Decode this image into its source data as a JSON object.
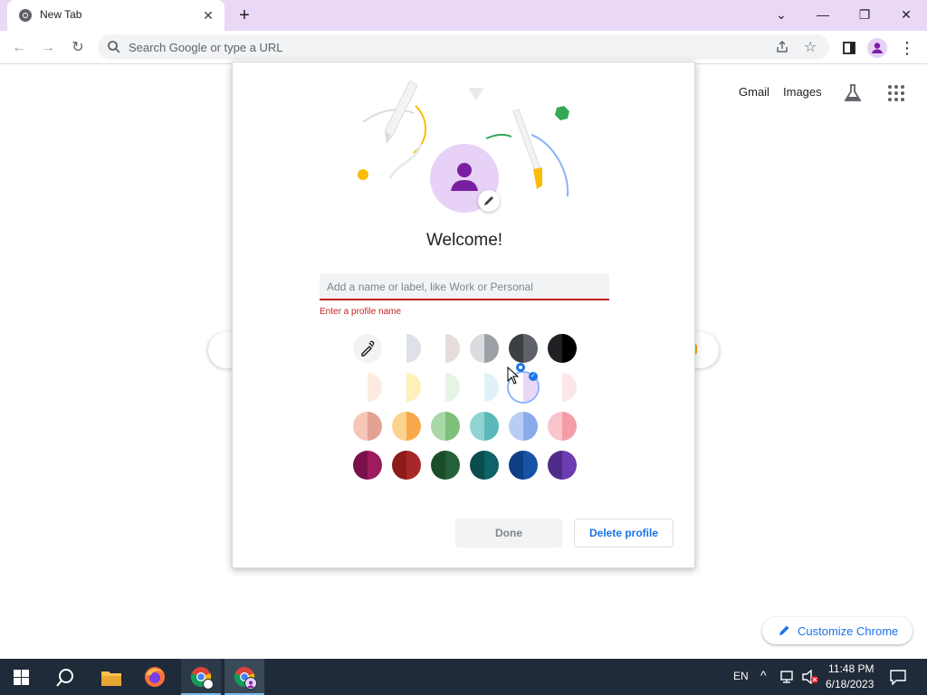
{
  "browser": {
    "tab_title": "New Tab",
    "omnibox_placeholder": "Search Google or type a URL"
  },
  "ntp": {
    "gmail_link": "Gmail",
    "images_link": "Images",
    "customize_label": "Customize Chrome"
  },
  "dialog": {
    "welcome": "Welcome!",
    "name_placeholder": "Add a name or label, like Work or Personal",
    "error": "Enter a profile name",
    "done_label": "Done",
    "delete_label": "Delete profile",
    "colors": {
      "row1": [
        {
          "name": "color-picker",
          "l": "#ffffff",
          "r": "#ffffff"
        },
        {
          "name": "grey-white",
          "l": "#ffffff",
          "r": "#dee1e6"
        },
        {
          "name": "warm-grey",
          "l": "#ffffff",
          "r": "#e6dcdc"
        },
        {
          "name": "medium-grey",
          "l": "#dadce0",
          "r": "#9aa0a6"
        },
        {
          "name": "dark-slate",
          "l": "#3c4043",
          "r": "#5f6368"
        },
        {
          "name": "black",
          "l": "#202124",
          "r": "#000000"
        }
      ],
      "row2": [
        {
          "name": "peach-white",
          "l": "#ffffff",
          "r": "#fcd3bd"
        },
        {
          "name": "yellow-white",
          "l": "#ffffff",
          "r": "#fde066"
        },
        {
          "name": "green-white",
          "l": "#ffffff",
          "r": "#c8e8c4"
        },
        {
          "name": "cyan-white",
          "l": "#ffffff",
          "r": "#b9e3f1"
        },
        {
          "name": "lavender-white",
          "l": "#ffffff",
          "r": "#e8d8f6"
        },
        {
          "name": "pink-white",
          "l": "#ffffff",
          "r": "#f8c9d0"
        }
      ],
      "row3": [
        {
          "name": "salmon",
          "l": "#f6c6b7",
          "r": "#e4a392"
        },
        {
          "name": "orange",
          "l": "#fcd28e",
          "r": "#f9a94b"
        },
        {
          "name": "green",
          "l": "#a8d8a8",
          "r": "#7cc07b"
        },
        {
          "name": "teal",
          "l": "#8fd3d3",
          "r": "#5ab8b8"
        },
        {
          "name": "blue",
          "l": "#b9cdf4",
          "r": "#8aabe9"
        },
        {
          "name": "pink",
          "l": "#fac4cd",
          "r": "#f59ca9"
        }
      ],
      "row4": [
        {
          "name": "magenta",
          "l": "#7a1049",
          "r": "#9c1c5d"
        },
        {
          "name": "red",
          "l": "#8e1a1a",
          "r": "#a8282a"
        },
        {
          "name": "dark-green",
          "l": "#1b4d2a",
          "r": "#24603a"
        },
        {
          "name": "dark-teal",
          "l": "#0b4c4f",
          "r": "#0f6266"
        },
        {
          "name": "navy",
          "l": "#0c3f86",
          "r": "#1652a6"
        },
        {
          "name": "purple",
          "l": "#4f2b8a",
          "r": "#6b3db0"
        }
      ]
    }
  },
  "taskbar": {
    "lang": "EN",
    "time": "11:48 PM",
    "date": "6/18/2023"
  }
}
